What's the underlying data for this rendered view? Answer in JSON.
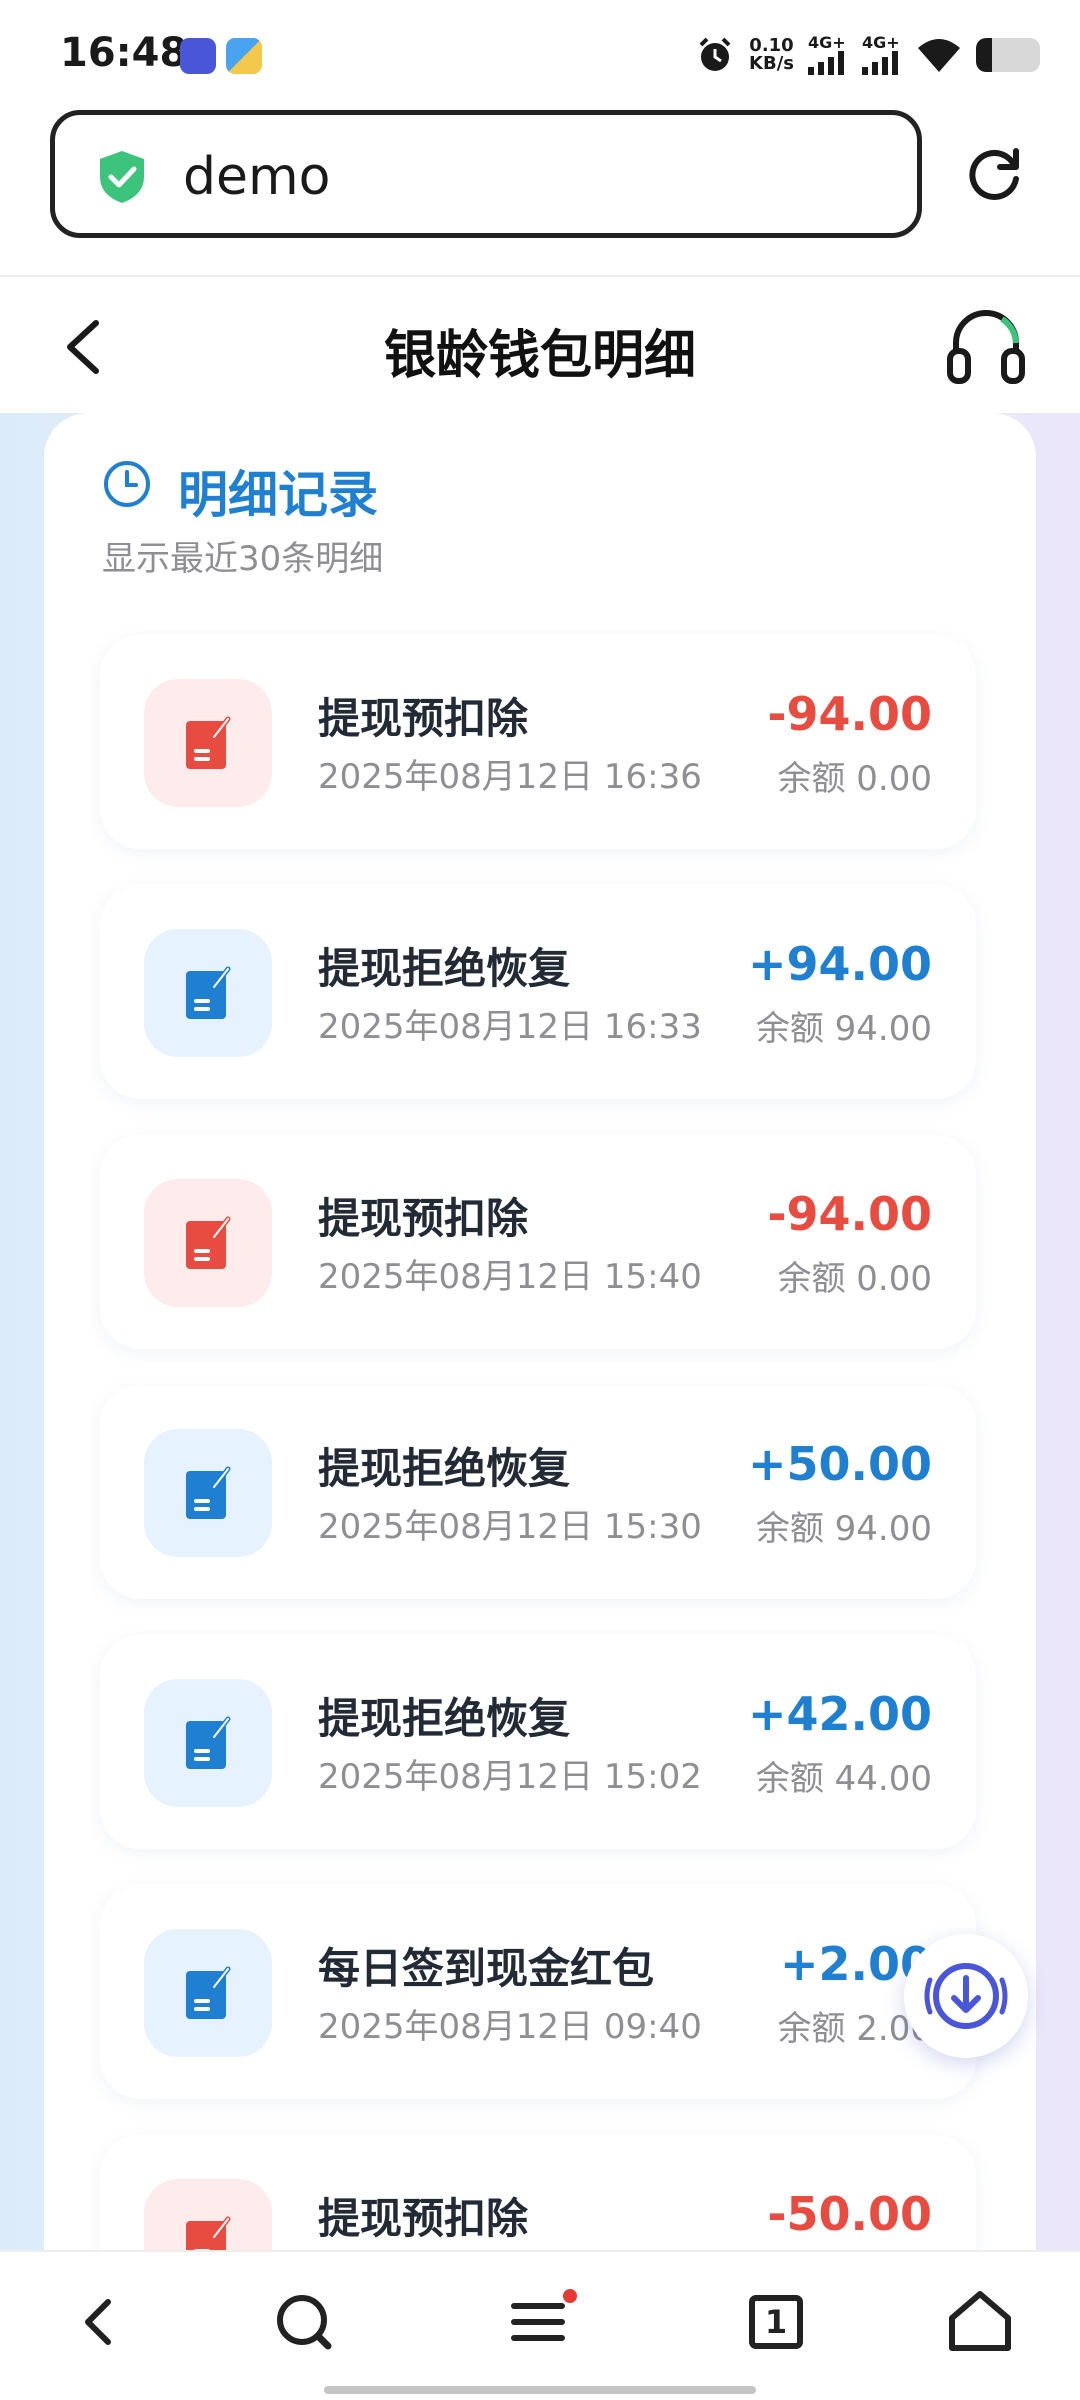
{
  "status_bar": {
    "time": "16:48",
    "net_speed_value": "0.10",
    "net_speed_unit": "KB/s",
    "signal_1": "4G+",
    "signal_2": "4G+",
    "battery_level": 0.25
  },
  "browser": {
    "url": "demo"
  },
  "header": {
    "title": "银龄钱包明细"
  },
  "section": {
    "title": "明细记录",
    "subtitle": "显示最近30条明细"
  },
  "records": [
    {
      "title": "提现预扣除",
      "time": "2025年08月12日 16:36",
      "amount": "-94.00",
      "balance": "余额 0.00",
      "type": "neg"
    },
    {
      "title": "提现拒绝恢复",
      "time": "2025年08月12日 16:33",
      "amount": "+94.00",
      "balance": "余额 94.00",
      "type": "pos"
    },
    {
      "title": "提现预扣除",
      "time": "2025年08月12日 15:40",
      "amount": "-94.00",
      "balance": "余额 0.00",
      "type": "neg"
    },
    {
      "title": "提现拒绝恢复",
      "time": "2025年08月12日 15:30",
      "amount": "+50.00",
      "balance": "余额 94.00",
      "type": "pos"
    },
    {
      "title": "提现拒绝恢复",
      "time": "2025年08月12日 15:02",
      "amount": "+42.00",
      "balance": "余额 44.00",
      "type": "pos"
    },
    {
      "title": "每日签到现金红包",
      "time": "2025年08月12日 09:40",
      "amount": "+2.00",
      "balance": "余额 2.00",
      "type": "pos"
    },
    {
      "title": "提现预扣除",
      "time": "",
      "amount": "-50.00",
      "balance": "",
      "type": "neg"
    }
  ],
  "bottom_nav": {
    "tab_count": "1"
  },
  "colors": {
    "primary_blue": "#1f7fd1",
    "negative_red": "#e84b40",
    "shield_green": "#3cc47c",
    "badge_red": "#e53935"
  }
}
